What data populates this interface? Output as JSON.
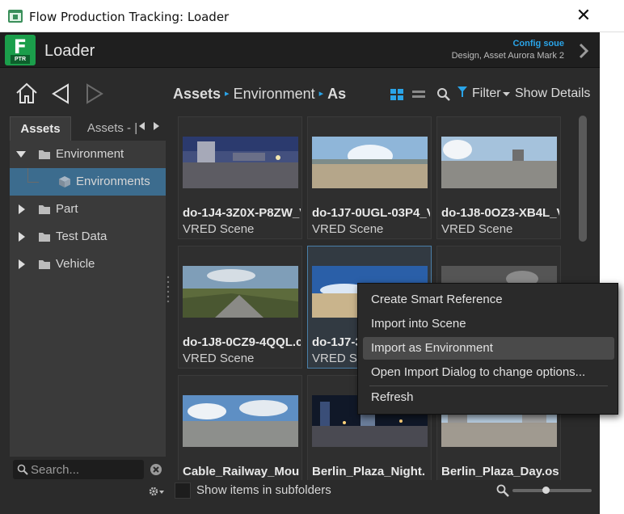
{
  "window": {
    "title": "Flow Production Tracking: Loader",
    "close_glyph": "✕"
  },
  "header": {
    "logo_letter": "F",
    "logo_badge": "PTR",
    "app_name": "Loader",
    "config_label": "Config soue",
    "config_context": "Design, Asset Aurora Mark 2"
  },
  "breadcrumb": {
    "items": [
      "Assets",
      "Environment",
      "As"
    ],
    "separator": "▸"
  },
  "toolbar": {
    "filter_label": "Filter",
    "details_label": "Show Details"
  },
  "left_panel": {
    "tabs": [
      {
        "label": "Assets",
        "active": true
      },
      {
        "label": "Assets - |",
        "active": false
      }
    ],
    "tree": [
      {
        "label": "Environment",
        "expanded": true
      },
      {
        "label": "Environments",
        "selected": true
      },
      {
        "label": "Part",
        "expanded": false
      },
      {
        "label": "Test Data",
        "expanded": false
      },
      {
        "label": "Vehicle",
        "expanded": false
      }
    ],
    "search_placeholder": "Search..."
  },
  "grid": {
    "items": [
      {
        "name": "do-1J4-3Z0X-P8ZW_V",
        "type": "VRED Scene"
      },
      {
        "name": "do-1J7-0UGL-03P4_V",
        "type": "VRED Scene"
      },
      {
        "name": "do-1J8-0OZ3-XB4L_V",
        "type": "VRED Scene"
      },
      {
        "name": "do-1J8-0CZ9-4QQL.c",
        "type": "VRED Scene"
      },
      {
        "name": "do-1J7-3",
        "type": "VRED Sc"
      },
      {
        "name": "",
        "type": ""
      },
      {
        "name": "Cable_Railway_Mou",
        "type": ""
      },
      {
        "name": "Berlin_Plaza_Night.",
        "type": ""
      },
      {
        "name": "Berlin_Plaza_Day.os",
        "type": ""
      }
    ]
  },
  "context_menu": {
    "items": [
      "Create Smart Reference",
      "Import into Scene",
      "Import as Environment",
      "Open Import Dialog to change options...",
      "Refresh"
    ],
    "hovered_index": 2
  },
  "bottom_bar": {
    "subfolders_label": "Show items in subfolders",
    "subfolders_checked": false,
    "zoom_level": 0.42
  },
  "colors": {
    "accent": "#2aa4e8",
    "selection": "#3c6c8e",
    "logo_green": "#1b9e4b"
  }
}
